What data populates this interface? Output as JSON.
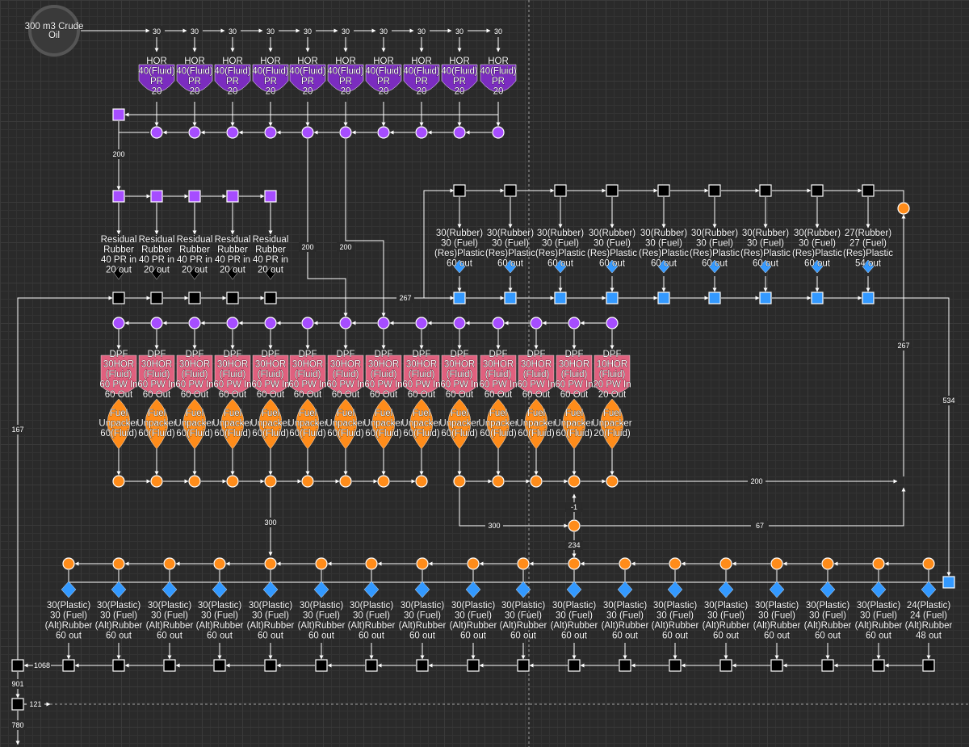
{
  "source": {
    "label_lines": [
      "300 m3 Crude",
      "Oil"
    ]
  },
  "top_split_values": [
    "30",
    "30",
    "30",
    "30",
    "30",
    "30",
    "30",
    "30",
    "30",
    "30"
  ],
  "hor_pr": {
    "lines": [
      "HOR",
      "40(Fluid)",
      "PR",
      "20"
    ],
    "count": 10
  },
  "residual_rubber": {
    "lines": [
      "Residual",
      "Rubber",
      "40 PR in",
      "20 out"
    ],
    "count": 5
  },
  "rubber_plastic": [
    {
      "lines": [
        "30(Rubber)",
        "30 (Fuel)",
        "(Res)Plastic",
        "60 out"
      ]
    },
    {
      "lines": [
        "30(Rubber)",
        "30 (Fuel)",
        "(Res)Plastic",
        "60 out"
      ]
    },
    {
      "lines": [
        "30(Rubber)",
        "30 (Fuel)",
        "(Res)Plastic",
        "60 out"
      ]
    },
    {
      "lines": [
        "30(Rubber)",
        "30 (Fuel)",
        "(Res)Plastic",
        "60 out"
      ]
    },
    {
      "lines": [
        "30(Rubber)",
        "30 (Fuel)",
        "(Res)Plastic",
        "60 out"
      ]
    },
    {
      "lines": [
        "30(Rubber)",
        "30 (Fuel)",
        "(Res)Plastic",
        "60 out"
      ]
    },
    {
      "lines": [
        "30(Rubber)",
        "30 (Fuel)",
        "(Res)Plastic",
        "60 out"
      ]
    },
    {
      "lines": [
        "30(Rubber)",
        "30 (Fuel)",
        "(Res)Plastic",
        "60 out"
      ]
    },
    {
      "lines": [
        "27(Rubber)",
        "27 (Fuel)",
        "(Res)Plastic",
        "54 out"
      ]
    }
  ],
  "dpf": [
    {
      "lines": [
        "DPF",
        "30HOR",
        "(Fluid)",
        "60 PW In",
        "60 Out"
      ]
    },
    {
      "lines": [
        "DPF",
        "30HOR",
        "(Fluid)",
        "60 PW In",
        "60 Out"
      ]
    },
    {
      "lines": [
        "DPF",
        "30HOR",
        "(Fluid)",
        "60 PW In",
        "60 Out"
      ]
    },
    {
      "lines": [
        "DPF",
        "30HOR",
        "(Fluid)",
        "60 PW In",
        "60 Out"
      ]
    },
    {
      "lines": [
        "DPF",
        "30HOR",
        "(Fluid)",
        "60 PW In",
        "60 Out"
      ]
    },
    {
      "lines": [
        "DPF",
        "30HOR",
        "(Fluid)",
        "60 PW In",
        "60 Out"
      ]
    },
    {
      "lines": [
        "DPF",
        "30HOR",
        "(Fluid)",
        "60 PW In",
        "60 Out"
      ]
    },
    {
      "lines": [
        "DPF",
        "30HOR",
        "(Fluid)",
        "60 PW In",
        "60 Out"
      ]
    },
    {
      "lines": [
        "DPF",
        "30HOR",
        "(Fluid)",
        "60 PW In",
        "60 Out"
      ]
    },
    {
      "lines": [
        "DPF",
        "30HOR",
        "(Fluid)",
        "60 PW In",
        "60 Out"
      ]
    },
    {
      "lines": [
        "DPF",
        "30HOR",
        "(Fluid)",
        "60 PW In",
        "60 Out"
      ]
    },
    {
      "lines": [
        "DPF",
        "30HOR",
        "(Fluid)",
        "60 PW In",
        "60 Out"
      ]
    },
    {
      "lines": [
        "DPF",
        "30HOR",
        "(Fluid)",
        "60 PW In",
        "60 Out"
      ]
    },
    {
      "lines": [
        "DPF",
        "10HOR",
        "(Fluid)",
        "20 PW In",
        "20 Out"
      ]
    }
  ],
  "fuel_unpacker": [
    {
      "lines": [
        "Fuel",
        "Unpacker",
        "60(Fluid)"
      ]
    },
    {
      "lines": [
        "Fuel",
        "Unpacker",
        "60(Fluid)"
      ]
    },
    {
      "lines": [
        "Fuel",
        "Unpacker",
        "60(Fluid)"
      ]
    },
    {
      "lines": [
        "Fuel",
        "Unpacker",
        "60(Fluid)"
      ]
    },
    {
      "lines": [
        "Fuel",
        "Unpacker",
        "60(Fluid)"
      ]
    },
    {
      "lines": [
        "Fuel",
        "Unpacker",
        "60(Fluid)"
      ]
    },
    {
      "lines": [
        "Fuel",
        "Unpacker",
        "60(Fluid)"
      ]
    },
    {
      "lines": [
        "Fuel",
        "Unpacker",
        "60(Fluid)"
      ]
    },
    {
      "lines": [
        "Fuel",
        "Unpacker",
        "60(Fluid)"
      ]
    },
    {
      "lines": [
        "Fuel",
        "Unpacker",
        "60(Fluid)"
      ]
    },
    {
      "lines": [
        "Fuel",
        "Unpacker",
        "60(Fluid)"
      ]
    },
    {
      "lines": [
        "Fuel",
        "Unpacker",
        "60(Fluid)"
      ]
    },
    {
      "lines": [
        "Fuel",
        "Unpacker",
        "60(Fluid)"
      ]
    },
    {
      "lines": [
        "Fuel",
        "Unpacker",
        "20(Fluid)"
      ]
    }
  ],
  "plastic_rubber": [
    {
      "lines": [
        "30(Plastic)",
        "30 (Fuel)",
        "(Alt)Rubber",
        "60 out"
      ]
    },
    {
      "lines": [
        "30(Plastic)",
        "30 (Fuel)",
        "(Alt)Rubber",
        "60 out"
      ]
    },
    {
      "lines": [
        "30(Plastic)",
        "30 (Fuel)",
        "(Alt)Rubber",
        "60 out"
      ]
    },
    {
      "lines": [
        "30(Plastic)",
        "30 (Fuel)",
        "(Alt)Rubber",
        "60 out"
      ]
    },
    {
      "lines": [
        "30(Plastic)",
        "30 (Fuel)",
        "(Alt)Rubber",
        "60 out"
      ]
    },
    {
      "lines": [
        "30(Plastic)",
        "30 (Fuel)",
        "(Alt)Rubber",
        "60 out"
      ]
    },
    {
      "lines": [
        "30(Plastic)",
        "30 (Fuel)",
        "(Alt)Rubber",
        "60 out"
      ]
    },
    {
      "lines": [
        "30(Plastic)",
        "30 (Fuel)",
        "(Alt)Rubber",
        "60 out"
      ]
    },
    {
      "lines": [
        "30(Plastic)",
        "30 (Fuel)",
        "(Alt)Rubber",
        "60 out"
      ]
    },
    {
      "lines": [
        "30(Plastic)",
        "30 (Fuel)",
        "(Alt)Rubber",
        "60 out"
      ]
    },
    {
      "lines": [
        "30(Plastic)",
        "30 (Fuel)",
        "(Alt)Rubber",
        "60 out"
      ]
    },
    {
      "lines": [
        "30(Plastic)",
        "30 (Fuel)",
        "(Alt)Rubber",
        "60 out"
      ]
    },
    {
      "lines": [
        "30(Plastic)",
        "30 (Fuel)",
        "(Alt)Rubber",
        "60 out"
      ]
    },
    {
      "lines": [
        "30(Plastic)",
        "30 (Fuel)",
        "(Alt)Rubber",
        "60 out"
      ]
    },
    {
      "lines": [
        "30(Plastic)",
        "30 (Fuel)",
        "(Alt)Rubber",
        "60 out"
      ]
    },
    {
      "lines": [
        "30(Plastic)",
        "30 (Fuel)",
        "(Alt)Rubber",
        "60 out"
      ]
    },
    {
      "lines": [
        "30(Plastic)",
        "30 (Fuel)",
        "(Alt)Rubber",
        "60 out"
      ]
    },
    {
      "lines": [
        "24(Plastic)",
        "24 (Fuel)",
        "(Alt)Rubber",
        "48 out"
      ]
    }
  ],
  "edge_labels": {
    "pr_to_residual": "200",
    "pr_down_a": "200",
    "pr_down_b": "200",
    "residual_to_plastic": "267",
    "left_return": "167",
    "right_267": "267",
    "right_534": "534",
    "fuel_right": "200",
    "fuel_down_300": "300",
    "fuel_mid_300": "300",
    "fuel_neg": "-1",
    "fuel_67": "67",
    "fuel_234": "234",
    "rubber_total": "1068",
    "rubber_901": "901",
    "rubber_121": "121",
    "rubber_780": "780"
  },
  "colors": {
    "purple": "#a64dff",
    "purple_dark": "#7b2cbf",
    "orange": "#ff8c1a",
    "blue": "#3399ff",
    "pink": "#e0607e",
    "black": "#000000",
    "line": "#ffffff"
  }
}
